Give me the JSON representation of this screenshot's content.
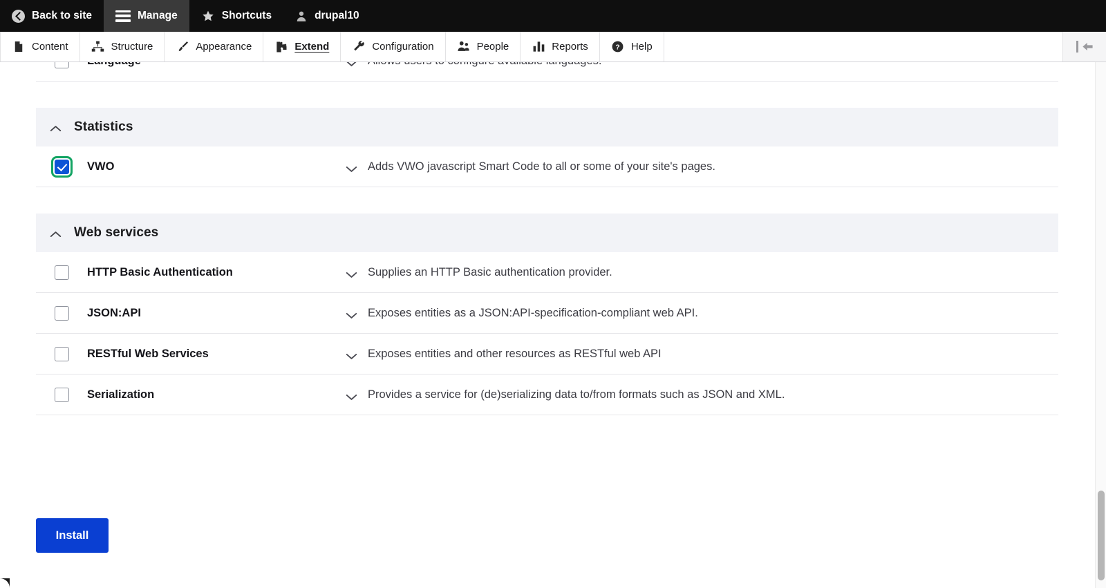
{
  "toolbar": {
    "items": [
      {
        "label": "Back to site",
        "icon": "back-arrow-circle-icon",
        "active": false
      },
      {
        "label": "Manage",
        "icon": "hamburger-icon",
        "active": true
      },
      {
        "label": "Shortcuts",
        "icon": "star-icon",
        "active": false
      },
      {
        "label": "drupal10",
        "icon": "user-avatar-icon",
        "active": false
      }
    ]
  },
  "menu": {
    "items": [
      {
        "label": "Content",
        "icon": "document-icon",
        "active": false
      },
      {
        "label": "Structure",
        "icon": "structure-icon",
        "active": false
      },
      {
        "label": "Appearance",
        "icon": "paintbrush-icon",
        "active": false
      },
      {
        "label": "Extend",
        "icon": "puzzle-piece-icon",
        "active": true
      },
      {
        "label": "Configuration",
        "icon": "wrench-icon",
        "active": false
      },
      {
        "label": "People",
        "icon": "people-icon",
        "active": false
      },
      {
        "label": "Reports",
        "icon": "bar-chart-icon",
        "active": false
      },
      {
        "label": "Help",
        "icon": "question-circle-icon",
        "active": false
      }
    ],
    "tray_toggle_icon": "collapse-tray-icon"
  },
  "modules": {
    "top_partial_row": {
      "name": "Language",
      "description": "Allows users to configure available languages.",
      "checked": false
    },
    "groups": [
      {
        "title": "Statistics",
        "collapse_icon": "chevron-up-icon",
        "rows": [
          {
            "name": "VWO",
            "description": "Adds VWO javascript Smart Code to all or some of your site's pages.",
            "checked": true,
            "focused": true
          }
        ]
      },
      {
        "title": "Web services",
        "collapse_icon": "chevron-up-icon",
        "rows": [
          {
            "name": "HTTP Basic Authentication",
            "description": "Supplies an HTTP Basic authentication provider.",
            "checked": false,
            "focused": false
          },
          {
            "name": "JSON:API",
            "description": "Exposes entities as a JSON:API-specification-compliant web API.",
            "checked": false,
            "focused": false
          },
          {
            "name": "RESTful Web Services",
            "description": "Exposes entities and other resources as RESTful web API",
            "checked": false,
            "focused": false
          },
          {
            "name": "Serialization",
            "description": "Provides a service for (de)serializing data to/from formats such as JSON and XML.",
            "checked": false,
            "focused": false
          }
        ]
      }
    ]
  },
  "actions": {
    "install_label": "Install"
  },
  "colors": {
    "toolbar_bg": "#0f0f0f",
    "toolbar_active_bg": "#3a3a3a",
    "group_header_bg": "#f2f3f7",
    "checkbox_checked": "#0d54d6",
    "focus_ring": "#13a463",
    "install_button": "#0a3fd2",
    "row_divider": "#e6e6ea"
  }
}
